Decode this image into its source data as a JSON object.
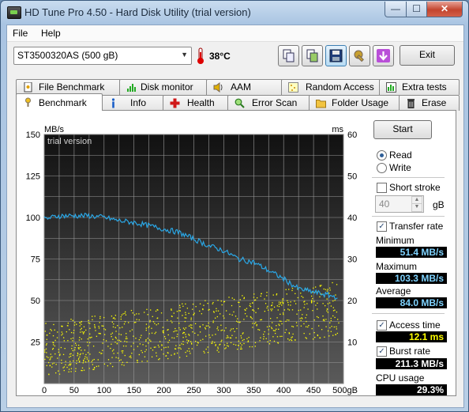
{
  "window": {
    "title": "HD Tune Pro 4.50 - Hard Disk Utility (trial version)",
    "min": "—",
    "max": "☐",
    "close": "✕"
  },
  "menu": {
    "file": "File",
    "help": "Help"
  },
  "toolbar": {
    "drive": "ST3500320AS (500 gB)",
    "temperature": "38°C",
    "exit": "Exit"
  },
  "tabs_top": [
    {
      "label": "File Benchmark",
      "icon": "file-benchmark-icon"
    },
    {
      "label": "Disk monitor",
      "icon": "disk-monitor-icon"
    },
    {
      "label": "AAM",
      "icon": "speaker-icon"
    },
    {
      "label": "Random Access",
      "icon": "random-access-icon"
    },
    {
      "label": "Extra tests",
      "icon": "extra-tests-icon"
    }
  ],
  "tabs_bottom": [
    {
      "label": "Benchmark",
      "icon": "benchmark-icon"
    },
    {
      "label": "Info",
      "icon": "info-icon"
    },
    {
      "label": "Health",
      "icon": "health-cross-icon"
    },
    {
      "label": "Error Scan",
      "icon": "magnifier-icon"
    },
    {
      "label": "Folder Usage",
      "icon": "folder-icon"
    },
    {
      "label": "Erase",
      "icon": "trash-icon"
    }
  ],
  "controls": {
    "start": "Start",
    "read": "Read",
    "write": "Write",
    "short_stroke": "Short stroke",
    "stroke_value": "40",
    "stroke_unit": "gB",
    "transfer_rate": "Transfer rate",
    "minimum_label": "Minimum",
    "minimum": "51.4 MB/s",
    "maximum_label": "Maximum",
    "maximum": "103.3 MB/s",
    "average_label": "Average",
    "average": "84.0 MB/s",
    "access_time": "Access time",
    "access_value": "12.1 ms",
    "burst_rate": "Burst rate",
    "burst_value": "211.3 MB/s",
    "cpu_label": "CPU usage",
    "cpu_value": "29.3%"
  },
  "colors": {
    "transfer_line": "#2aa7e6",
    "access_points": "#ffff00",
    "plot_bg_top": "#111111",
    "plot_bg_bottom": "#5a5a5a"
  },
  "chart_data": {
    "type": "line",
    "watermark": "trial version",
    "y_left_label": "MB/s",
    "y_right_label": "ms",
    "y_left_ticks": [
      "150",
      "125",
      "100",
      "75",
      "50",
      "25"
    ],
    "y_right_ticks": [
      "60",
      "50",
      "40",
      "30",
      "20",
      "10"
    ],
    "x_ticks": [
      "0",
      "50",
      "100",
      "150",
      "200",
      "250",
      "300",
      "350",
      "400",
      "450",
      "500gB"
    ],
    "xlim": [
      0,
      500
    ],
    "ylim_left": [
      0,
      150
    ],
    "ylim_right": [
      0,
      60
    ],
    "grid": true,
    "series": [
      {
        "name": "Transfer rate",
        "axis": "left",
        "x": [
          0,
          25,
          50,
          75,
          100,
          125,
          150,
          175,
          200,
          225,
          250,
          275,
          300,
          325,
          350,
          375,
          400,
          425,
          490
        ],
        "y": [
          99,
          101,
          101,
          101,
          100,
          98,
          97,
          95,
          93,
          91,
          87,
          83,
          80,
          75,
          73,
          68,
          63,
          57,
          52
        ]
      },
      {
        "name": "Access time",
        "axis": "right",
        "style": "scatter",
        "x": [
          0,
          50,
          100,
          150,
          200,
          250,
          300,
          350,
          400,
          450,
          490
        ],
        "y": [
          9,
          10,
          11,
          12,
          13,
          14,
          15,
          16,
          17,
          18,
          19
        ]
      }
    ]
  }
}
